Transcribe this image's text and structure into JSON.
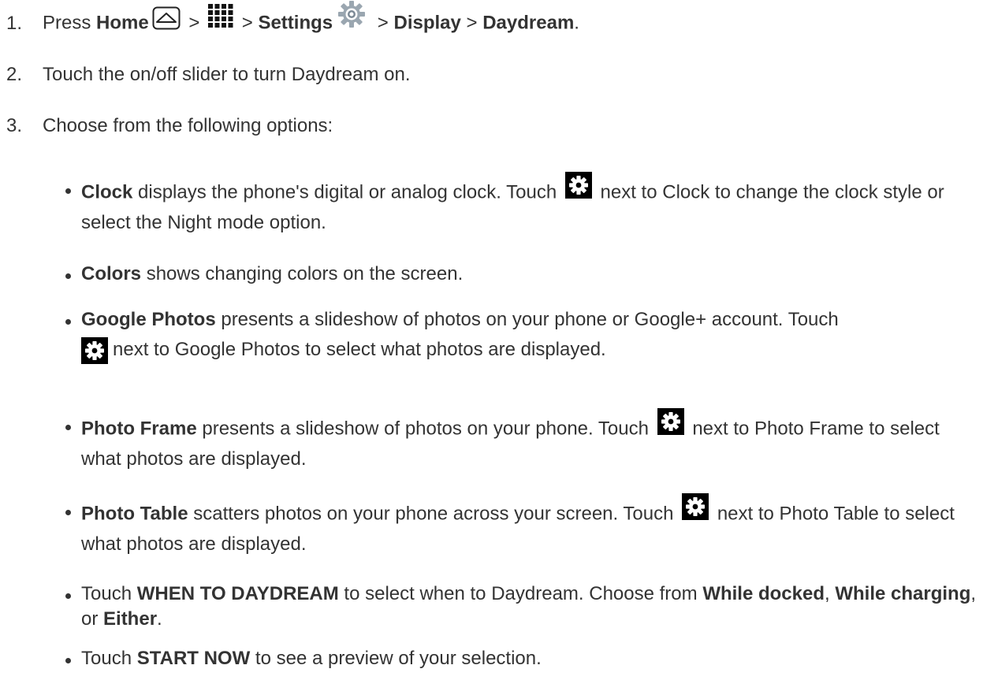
{
  "steps": [
    {
      "number": "1.",
      "press": "Press",
      "home": "Home",
      "sep1": ">",
      "sep2": ">",
      "settings": "Settings",
      "sep3": ">",
      "display": "Display",
      "sep4": ">",
      "daydream": "Daydream",
      "end": "."
    },
    {
      "number": "2.",
      "text": "Touch the on/off slider to turn Daydream on."
    },
    {
      "number": "3.",
      "text": "Choose from the following options:"
    }
  ],
  "options": {
    "clock": {
      "bold": "Clock",
      "text1": "displays the phone's digital or analog clock. Touch",
      "text2": "next to Clock to change the clock style or select the Night mode option."
    },
    "colors": {
      "bold": "Colors",
      "text1": "shows changing colors on the screen."
    },
    "google_photos": {
      "bold": "Google Photos",
      "text1": "presents a slideshow of photos on your phone or Google+ account. Touch",
      "text2": "next to Google Photos to select what photos are displayed."
    },
    "photo_frame": {
      "bold": "Photo Frame",
      "text1": "presents a slideshow of photos on your phone. Touch",
      "text2": "next to Photo Frame to select what photos are displayed."
    },
    "photo_table": {
      "bold": "Photo Table",
      "text1": "scatters photos on your phone across your screen. Touch",
      "text2": "next to Photo Table to select what photos are displayed."
    },
    "when_to_daydream": {
      "t1": "Touch",
      "b1": "WHEN TO DAYDREAM",
      "t2": "to select when to Daydream. Choose from",
      "b2": "While docked",
      "t3": ",",
      "b3": "While charging",
      "t4": ", or",
      "b4": "Either",
      "t5": "."
    },
    "start_now": {
      "t1": "Touch",
      "b1": "START NOW",
      "t2": "to see a preview of your selection."
    }
  },
  "icons": {
    "home": "home-icon",
    "apps": "apps-grid-icon",
    "settings": "settings-gear-icon",
    "options_settings": "gear-icon"
  },
  "colors": {
    "text": "#333333",
    "gear_box": "#000000",
    "settings_icon": "#9aa6b0"
  }
}
